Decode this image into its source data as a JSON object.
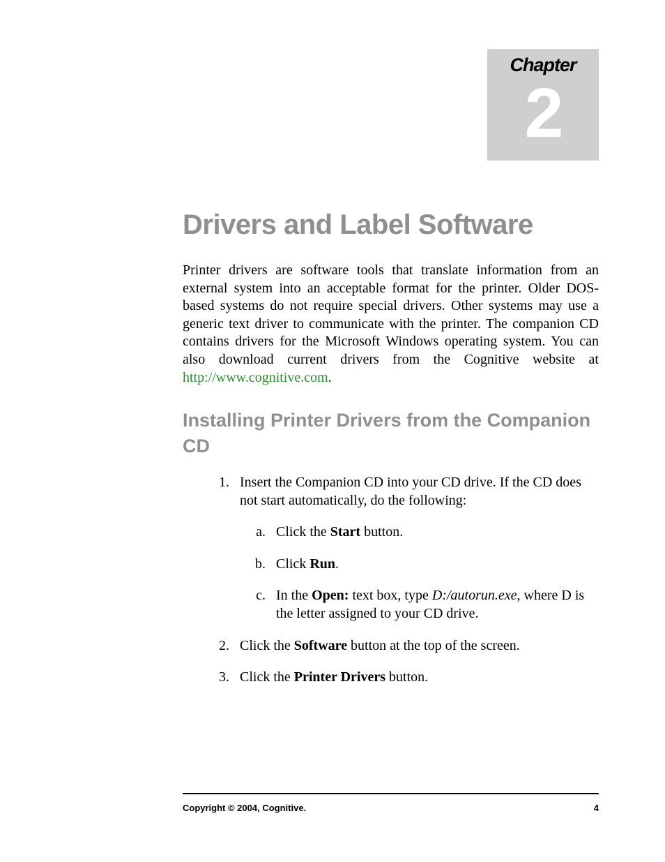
{
  "chapter": {
    "label": "Chapter",
    "number": "2"
  },
  "title": "Drivers and Label Software",
  "intro": {
    "part1": "Printer drivers are software tools that translate information from an external system into an acceptable format for the printer. Older DOS-based systems do not require special drivers. Other systems may use a generic text driver to communicate with the printer. The companion CD contains drivers for the Microsoft Windows operating system. You can also download current drivers from the Cognitive website at ",
    "link": "http://www.cognitive.com",
    "part2": "."
  },
  "section_heading": "Installing Printer Drivers from the Companion CD",
  "steps": {
    "s1_intro": "Insert the Companion CD into your CD drive. If the CD does not start automatically, do the following:",
    "s1a_pre": "Click the ",
    "s1a_bold": "Start",
    "s1a_post": " button.",
    "s1b_pre": "Click ",
    "s1b_bold": "Run",
    "s1b_post": ".",
    "s1c_pre": "In the ",
    "s1c_bold": "Open:",
    "s1c_mid": " text box, type ",
    "s1c_italic": "D:/autorun.exe",
    "s1c_post": ", where D is the letter assigned to your CD drive.",
    "s2_pre": "Click the ",
    "s2_bold": "Software",
    "s2_post": " button at the top of the screen.",
    "s3_pre": "Click the ",
    "s3_bold": "Printer Drivers",
    "s3_post": " button."
  },
  "footer": {
    "copyright": "Copyright © 2004, Cognitive.",
    "page": "4"
  }
}
